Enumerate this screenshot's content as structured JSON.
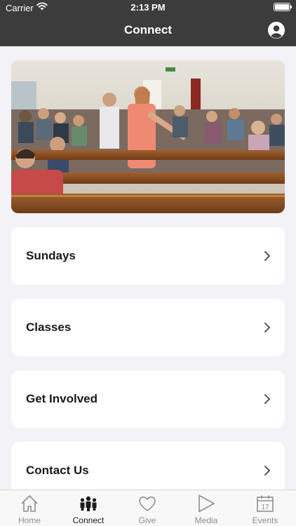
{
  "status_bar": {
    "carrier": "Carrier",
    "time": "2:13 PM"
  },
  "header": {
    "title": "Connect"
  },
  "hero": {
    "alt": "Congregation gathered in church pews"
  },
  "menu": [
    {
      "label": "Sundays"
    },
    {
      "label": "Classes"
    },
    {
      "label": "Get Involved"
    },
    {
      "label": "Contact Us"
    }
  ],
  "tabs": [
    {
      "label": "Home",
      "icon": "home-icon",
      "active": false
    },
    {
      "label": "Connect",
      "icon": "people-icon",
      "active": true
    },
    {
      "label": "Give",
      "icon": "heart-icon",
      "active": false
    },
    {
      "label": "Media",
      "icon": "play-icon",
      "active": false
    },
    {
      "label": "Events",
      "icon": "calendar-icon",
      "active": false
    }
  ],
  "calendar_day": "17",
  "colors": {
    "header_bg": "#3c3c3c",
    "page_bg": "#f2f2f7",
    "active_tab": "#1c1c1e",
    "inactive_tab": "#8e8e93"
  }
}
